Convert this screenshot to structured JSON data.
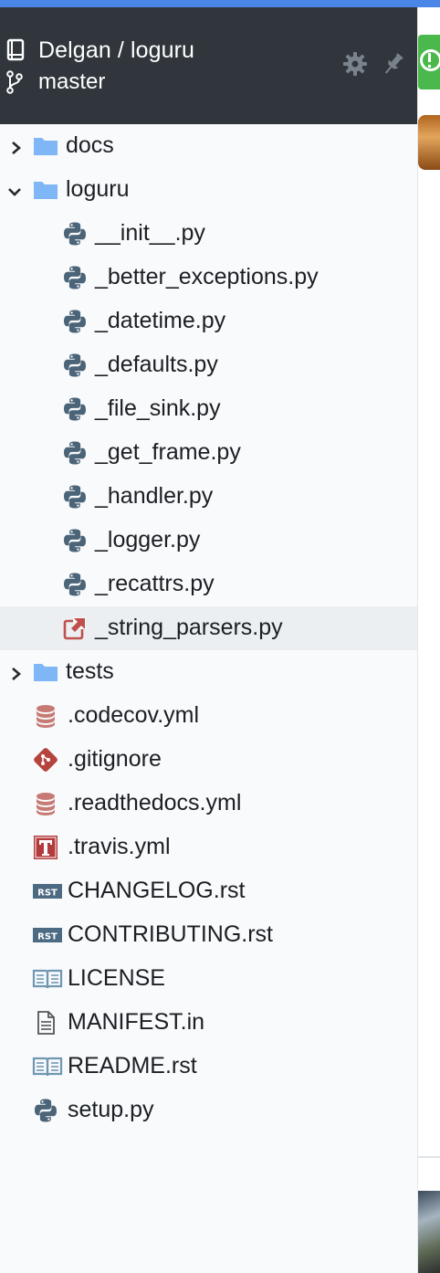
{
  "header": {
    "repo": "Delgan / loguru",
    "branch": "master"
  },
  "tree": {
    "folders": {
      "docs": "docs",
      "loguru": "loguru",
      "tests": "tests"
    },
    "loguru_files": [
      "__init__.py",
      "_better_exceptions.py",
      "_datetime.py",
      "_defaults.py",
      "_file_sink.py",
      "_get_frame.py",
      "_handler.py",
      "_logger.py",
      "_recattrs.py",
      "_string_parsers.py"
    ],
    "root_files": [
      ".codecov.yml",
      ".gitignore",
      ".readthedocs.yml",
      ".travis.yml",
      "CHANGELOG.rst",
      "CONTRIBUTING.rst",
      "LICENSE",
      "MANIFEST.in",
      "README.rst",
      "setup.py"
    ],
    "selected": "_string_parsers.py"
  },
  "colors": {
    "header_bg": "#30363b",
    "folder": "#7fb6f6",
    "python": "#4b6478",
    "yaml": "#c77a73",
    "git": "#b6443e",
    "travis": "#b33b3b",
    "rst": "#4c6a82",
    "book": "#6f97b2",
    "selected_bg": "#eceff1"
  },
  "icons": {
    "repo": "book-icon",
    "branch": "git-branch-icon",
    "settings": "gear-icon",
    "pin": "pin-icon"
  }
}
